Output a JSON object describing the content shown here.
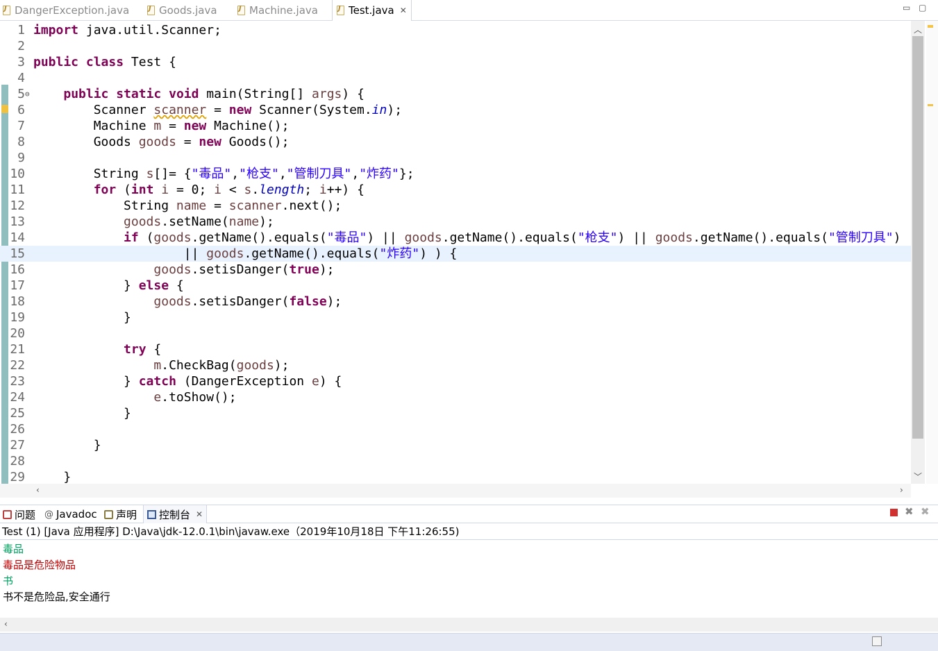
{
  "editor_tabs": [
    {
      "label": "DangerException.java",
      "active": false
    },
    {
      "label": "Goods.java",
      "active": false
    },
    {
      "label": "Machine.java",
      "active": false
    },
    {
      "label": "Test.java",
      "active": true
    }
  ],
  "close_glyph": "✕",
  "code": {
    "line_numbers": [
      "1",
      "2",
      "3",
      "4",
      "5",
      "6",
      "7",
      "8",
      "9",
      "10",
      "11",
      "12",
      "13",
      "14",
      "15",
      "16",
      "17",
      "18",
      "19",
      "20",
      "21",
      "22",
      "23",
      "24",
      "25",
      "26",
      "27",
      "28",
      "29"
    ],
    "lines": [
      [
        {
          "t": "import",
          "c": "kw"
        },
        {
          "t": " java.util.Scanner;"
        }
      ],
      [],
      [
        {
          "t": "public",
          "c": "kw"
        },
        {
          "t": " "
        },
        {
          "t": "class",
          "c": "kw"
        },
        {
          "t": " Test {"
        }
      ],
      [],
      [
        {
          "t": "    "
        },
        {
          "t": "public",
          "c": "kw"
        },
        {
          "t": " "
        },
        {
          "t": "static",
          "c": "kw"
        },
        {
          "t": " "
        },
        {
          "t": "void",
          "c": "kw"
        },
        {
          "t": " main(String[] "
        },
        {
          "t": "args",
          "c": "var"
        },
        {
          "t": ") {"
        }
      ],
      [
        {
          "t": "        Scanner "
        },
        {
          "t": "scanner",
          "c": "var warn"
        },
        {
          "t": " = "
        },
        {
          "t": "new",
          "c": "kw"
        },
        {
          "t": " Scanner(System."
        },
        {
          "t": "in",
          "c": "fld"
        },
        {
          "t": ");"
        }
      ],
      [
        {
          "t": "        Machine "
        },
        {
          "t": "m",
          "c": "var"
        },
        {
          "t": " = "
        },
        {
          "t": "new",
          "c": "kw"
        },
        {
          "t": " Machine();"
        }
      ],
      [
        {
          "t": "        Goods "
        },
        {
          "t": "goods",
          "c": "var"
        },
        {
          "t": " = "
        },
        {
          "t": "new",
          "c": "kw"
        },
        {
          "t": " Goods();"
        }
      ],
      [],
      [
        {
          "t": "        String "
        },
        {
          "t": "s",
          "c": "var"
        },
        {
          "t": "[]= {"
        },
        {
          "t": "\"毒品\"",
          "c": "str"
        },
        {
          "t": ","
        },
        {
          "t": "\"枪支\"",
          "c": "str"
        },
        {
          "t": ","
        },
        {
          "t": "\"管制刀具\"",
          "c": "str"
        },
        {
          "t": ","
        },
        {
          "t": "\"炸药\"",
          "c": "str"
        },
        {
          "t": "};"
        }
      ],
      [
        {
          "t": "        "
        },
        {
          "t": "for",
          "c": "kw"
        },
        {
          "t": " ("
        },
        {
          "t": "int",
          "c": "kw"
        },
        {
          "t": " "
        },
        {
          "t": "i",
          "c": "var"
        },
        {
          "t": " = 0; "
        },
        {
          "t": "i",
          "c": "var"
        },
        {
          "t": " < "
        },
        {
          "t": "s",
          "c": "var"
        },
        {
          "t": "."
        },
        {
          "t": "length",
          "c": "fld"
        },
        {
          "t": "; "
        },
        {
          "t": "i",
          "c": "var"
        },
        {
          "t": "++) {"
        }
      ],
      [
        {
          "t": "            String "
        },
        {
          "t": "name",
          "c": "var"
        },
        {
          "t": " = "
        },
        {
          "t": "scanner",
          "c": "var"
        },
        {
          "t": ".next();"
        }
      ],
      [
        {
          "t": "            "
        },
        {
          "t": "goods",
          "c": "var"
        },
        {
          "t": ".setName("
        },
        {
          "t": "name",
          "c": "var"
        },
        {
          "t": ");"
        }
      ],
      [
        {
          "t": "            "
        },
        {
          "t": "if",
          "c": "kw"
        },
        {
          "t": " ("
        },
        {
          "t": "goods",
          "c": "var"
        },
        {
          "t": ".getName().equals("
        },
        {
          "t": "\"毒品\"",
          "c": "str"
        },
        {
          "t": ") || "
        },
        {
          "t": "goods",
          "c": "var"
        },
        {
          "t": ".getName().equals("
        },
        {
          "t": "\"枪支\"",
          "c": "str"
        },
        {
          "t": ") || "
        },
        {
          "t": "goods",
          "c": "var"
        },
        {
          "t": ".getName().equals("
        },
        {
          "t": "\"管制刀具\"",
          "c": "str"
        },
        {
          "t": ")"
        }
      ],
      [
        {
          "t": "                    || "
        },
        {
          "t": "goods",
          "c": "var"
        },
        {
          "t": ".getName().equals("
        },
        {
          "t": "\"炸药\"",
          "c": "str"
        },
        {
          "t": ") ) {"
        }
      ],
      [
        {
          "t": "                "
        },
        {
          "t": "goods",
          "c": "var"
        },
        {
          "t": ".setisDanger("
        },
        {
          "t": "true",
          "c": "kw"
        },
        {
          "t": ");"
        }
      ],
      [
        {
          "t": "            } "
        },
        {
          "t": "else",
          "c": "kw"
        },
        {
          "t": " {"
        }
      ],
      [
        {
          "t": "                "
        },
        {
          "t": "goods",
          "c": "var"
        },
        {
          "t": ".setisDanger("
        },
        {
          "t": "false",
          "c": "kw"
        },
        {
          "t": ");"
        }
      ],
      [
        {
          "t": "            }"
        }
      ],
      [],
      [
        {
          "t": "            "
        },
        {
          "t": "try",
          "c": "kw"
        },
        {
          "t": " {"
        }
      ],
      [
        {
          "t": "                "
        },
        {
          "t": "m",
          "c": "var"
        },
        {
          "t": ".CheckBag("
        },
        {
          "t": "goods",
          "c": "var"
        },
        {
          "t": ");"
        }
      ],
      [
        {
          "t": "            } "
        },
        {
          "t": "catch",
          "c": "kw"
        },
        {
          "t": " (DangerException "
        },
        {
          "t": "e",
          "c": "var"
        },
        {
          "t": ") {"
        }
      ],
      [
        {
          "t": "                "
        },
        {
          "t": "e",
          "c": "var"
        },
        {
          "t": ".toShow();"
        }
      ],
      [
        {
          "t": "            }"
        }
      ],
      [],
      [
        {
          "t": "        }"
        }
      ],
      [],
      [
        {
          "t": "    }"
        }
      ]
    ],
    "current_line_index": 14
  },
  "panel_tabs": [
    {
      "label": "问题",
      "icon": "problems-icon",
      "active": false
    },
    {
      "label": "Javadoc",
      "icon": "at-icon",
      "active": false
    },
    {
      "label": "声明",
      "icon": "declaration-icon",
      "active": false
    },
    {
      "label": "控制台",
      "icon": "console-icon",
      "active": true
    }
  ],
  "console": {
    "header": "Test (1)  [Java 应用程序] D:\\Java\\jdk-12.0.1\\bin\\javaw.exe（2019年10月18日 下午11:26:55)",
    "lines": [
      {
        "text": "毒品",
        "kind": "c-in"
      },
      {
        "text": "毒品是危险物品",
        "kind": "c-err"
      },
      {
        "text": "书",
        "kind": "c-in"
      },
      {
        "text": "书不是危险品,安全通行",
        "kind": "c-out"
      }
    ]
  },
  "colors": {
    "keyword": "#7f0055",
    "string": "#2a00ff",
    "field": "#0000c0",
    "variable": "#6a3e3e"
  }
}
